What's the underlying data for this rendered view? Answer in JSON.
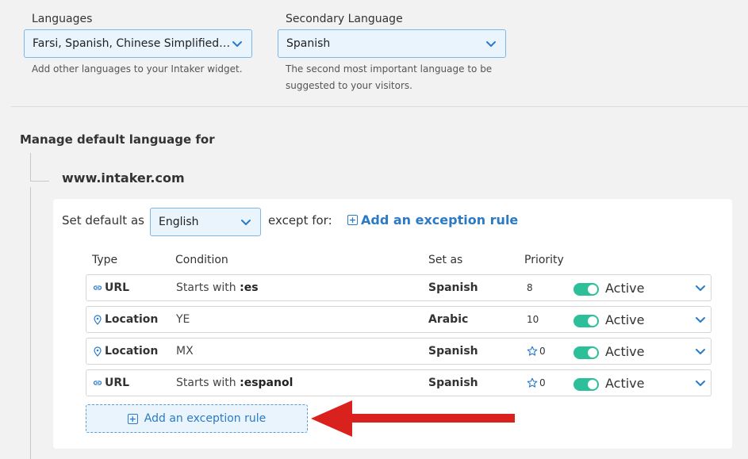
{
  "languages": {
    "label": "Languages",
    "value": "Farsi, Spanish, Chinese Simplified, Ar...",
    "help": "Add other languages to your Intaker widget."
  },
  "secondary_language": {
    "label": "Secondary Language",
    "value": "Spanish",
    "help_line1": "The second most important language to be",
    "help_line2": "suggested to your visitors."
  },
  "manage": {
    "title": "Manage default language for",
    "domain": "www.intaker.com",
    "set_default_label": "Set default as",
    "default_value": "English",
    "except_label": "except for:",
    "add_rule_label": "Add an exception rule"
  },
  "table": {
    "headers": {
      "type": "Type",
      "condition": "Condition",
      "set_as": "Set as",
      "priority": "Priority"
    },
    "rows": [
      {
        "type": "URL",
        "type_icon": "link-icon",
        "condition_prefix": "Starts with ",
        "condition_value": ":es",
        "set_as": "Spanish",
        "priority": "8",
        "starred": false,
        "status": "Active"
      },
      {
        "type": "Location",
        "type_icon": "location-pin-icon",
        "condition_prefix": "",
        "condition_value": "YE",
        "set_as": "Arabic",
        "priority": "10",
        "starred": false,
        "status": "Active"
      },
      {
        "type": "Location",
        "type_icon": "location-pin-icon",
        "condition_prefix": "",
        "condition_value": "MX",
        "set_as": "Spanish",
        "priority": "0",
        "starred": true,
        "status": "Active"
      },
      {
        "type": "URL",
        "type_icon": "link-icon",
        "condition_prefix": "Starts with ",
        "condition_value": ":espanol",
        "set_as": "Spanish",
        "priority": "0",
        "starred": true,
        "status": "Active"
      }
    ]
  },
  "add_button_label": "Add an exception rule",
  "colors": {
    "accent": "#2a7ac7",
    "toggle_on": "#2bbf9a",
    "arrow": "#d9211e",
    "field_bg": "#e9f4fd"
  }
}
